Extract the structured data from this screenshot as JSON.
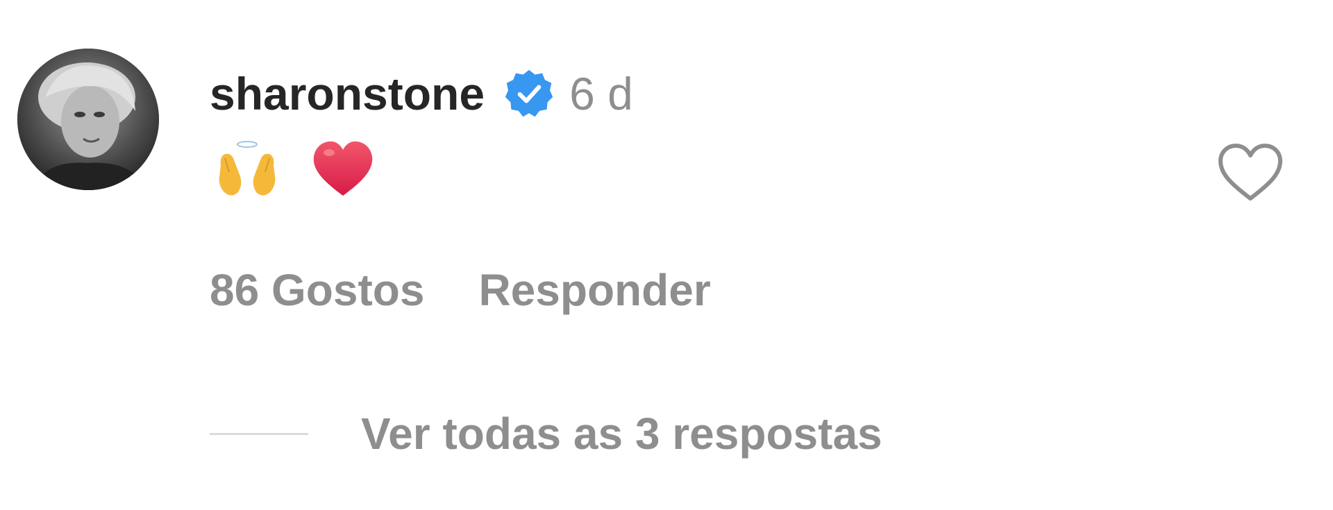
{
  "comment": {
    "username": "sharonstone",
    "timestamp": "6 d",
    "body_emojis": [
      "emoji-raising-hands-icon",
      "emoji-red-heart-icon"
    ],
    "likes_label": "86 Gostos",
    "reply_label": "Responder",
    "view_replies_label": "Ver todas as 3 respostas"
  },
  "icons": {
    "verified": "verified-badge-icon",
    "like": "heart-outline-icon"
  },
  "colors": {
    "username": "#262626",
    "secondary_text": "#8e8e8e",
    "verified_blue": "#3897f0",
    "divider": "#dbdbdb",
    "emoji_heart": "#e8344d",
    "emoji_hands": "#f5b93a"
  }
}
